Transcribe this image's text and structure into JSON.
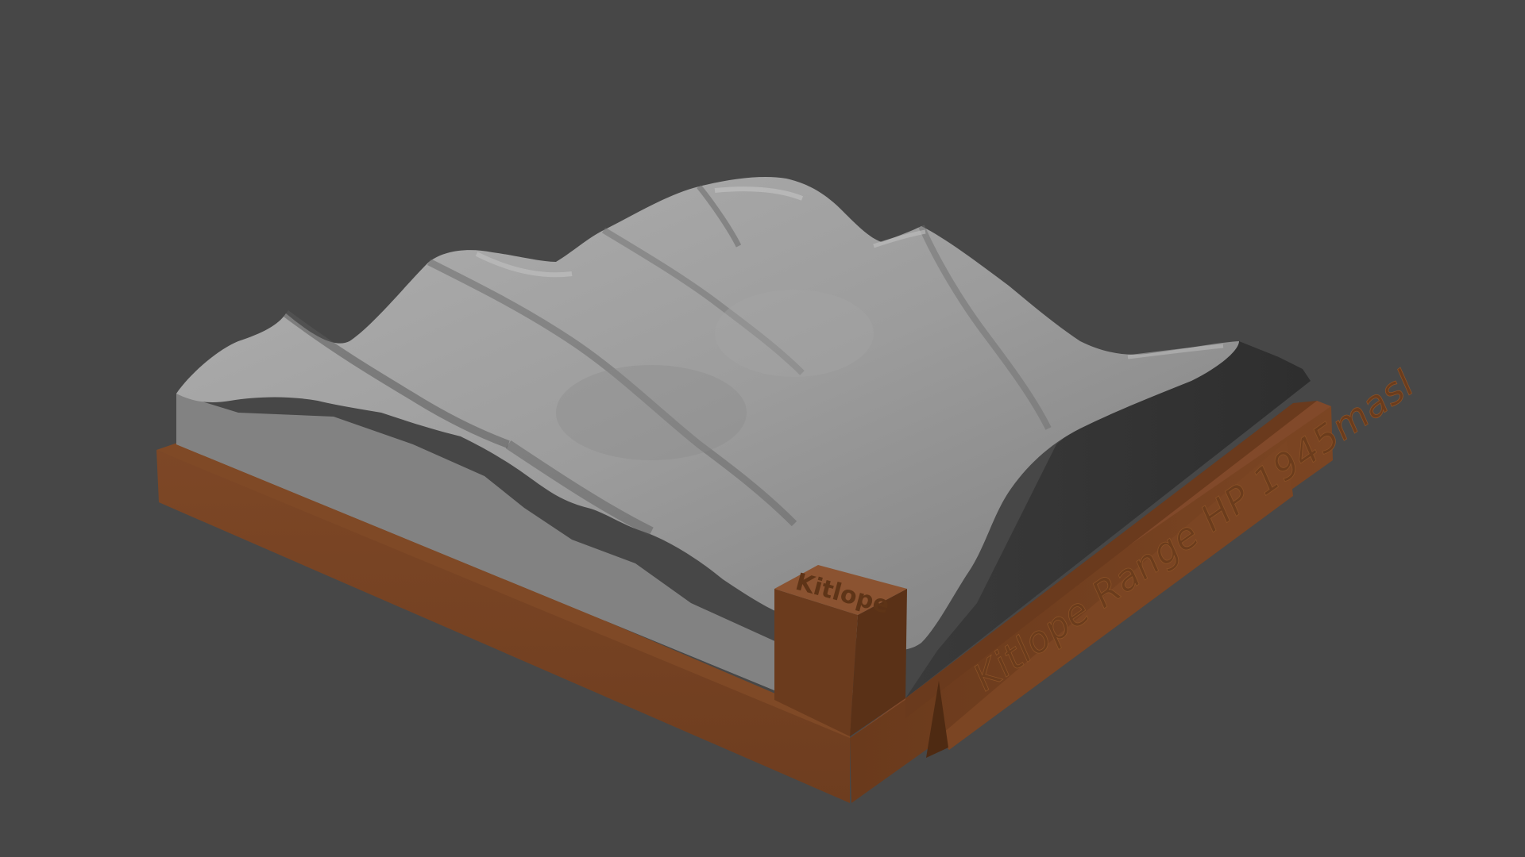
{
  "viewport": {
    "background_color": "#474747"
  },
  "model": {
    "terrain_color": "#9a9a9a",
    "terrain_shadow_color": "#5c5c5c",
    "base_color": "#7a4524",
    "base_dark_color": "#5e3417",
    "engraved_label": "Kitlope Range HP 1945masl",
    "corner_marker_label": "Kitlope",
    "north_arrow_icon": "triangle-arrow-icon"
  }
}
